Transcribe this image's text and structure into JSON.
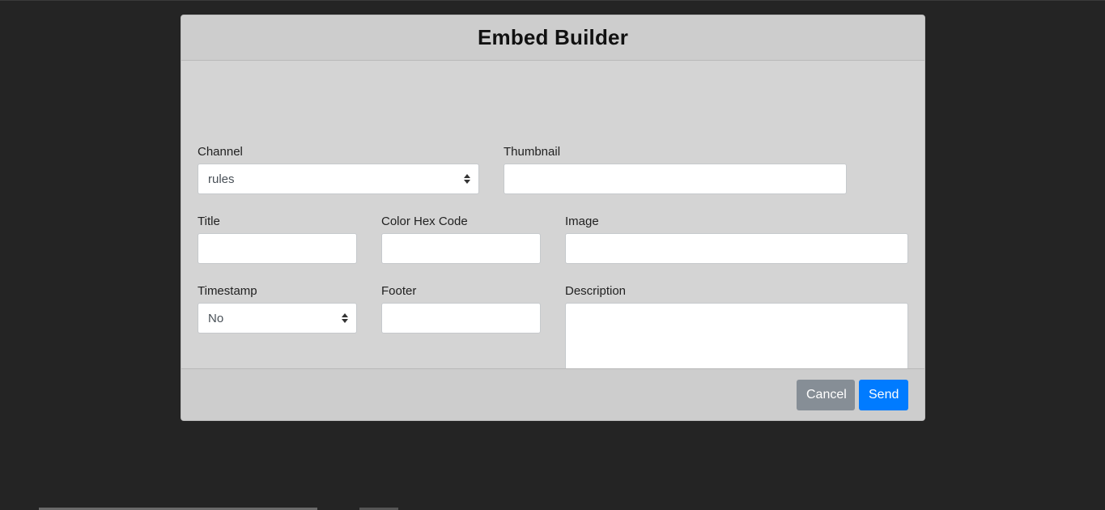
{
  "modal": {
    "title": "Embed Builder"
  },
  "form": {
    "channel": {
      "label": "Channel",
      "value": "rules"
    },
    "thumbnail": {
      "label": "Thumbnail",
      "value": ""
    },
    "title": {
      "label": "Title",
      "value": ""
    },
    "color_hex_code": {
      "label": "Color Hex Code",
      "value": ""
    },
    "image": {
      "label": "Image",
      "value": ""
    },
    "timestamp": {
      "label": "Timestamp",
      "value": "No"
    },
    "footer": {
      "label": "Footer",
      "value": ""
    },
    "description": {
      "label": "Description",
      "value": ""
    }
  },
  "footer": {
    "cancel_label": "Cancel",
    "send_label": "Send"
  },
  "colors": {
    "backdrop": "#242424",
    "modal_bg": "#d4d4d4",
    "cancel_button": "#868e96",
    "send_button": "#007bff"
  }
}
